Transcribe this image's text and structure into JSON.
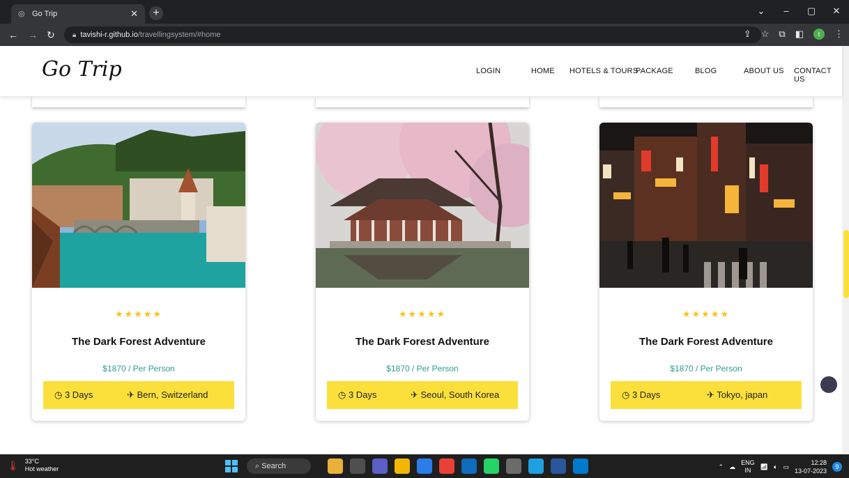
{
  "browser": {
    "tab_title": "Go Trip",
    "url_host": "tavishi-r.github.io",
    "url_path": "/travellingsystem/#home"
  },
  "site": {
    "logo": "Go Trip",
    "nav": [
      "LOGIN",
      "HOME",
      "HOTELS & TOURS",
      "PACKAGE",
      "BLOG",
      "ABOUT US",
      "CONTACT US"
    ]
  },
  "cards": [
    {
      "title": "The Dark Forest Adventure",
      "price": "$1870 / Per Person",
      "days": "3 Days",
      "place": "Bern, Switzerland",
      "rating": 5
    },
    {
      "title": "The Dark Forest Adventure",
      "price": "$1870 / Per Person",
      "days": "3 Days",
      "place": "Seoul, South Korea",
      "rating": 5
    },
    {
      "title": "The Dark Forest Adventure",
      "price": "$1870 / Per Person",
      "days": "3 Days",
      "place": "Tokyo, japan",
      "rating": 5
    }
  ],
  "taskbar": {
    "temp": "33°C",
    "weather": "Hot weather",
    "search_label": "Search",
    "lang_top": "ENG",
    "lang_bottom": "IN",
    "time": "12:28",
    "date": "13-07-2023",
    "notification_count": "9"
  },
  "colors": {
    "accent_yellow": "#fbe03b",
    "price_teal": "#2a9d8f",
    "star_gold": "#f5c518"
  }
}
